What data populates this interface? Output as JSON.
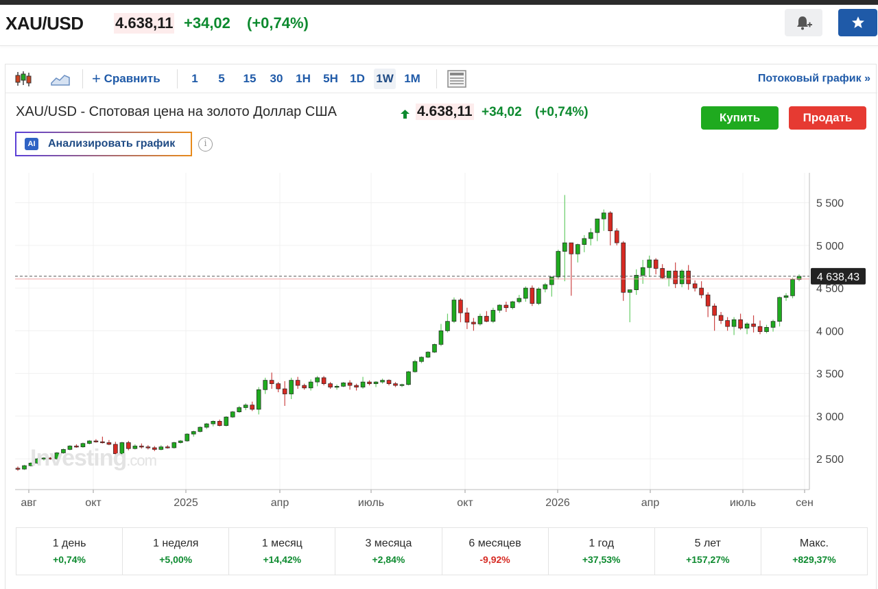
{
  "header": {
    "symbol": "XAU/USD",
    "price": "4.638,11",
    "change": "+34,02",
    "change_pct": "(+0,74%)"
  },
  "toolbar": {
    "compare_label": "Сравнить",
    "intervals": [
      "1",
      "5",
      "15",
      "30",
      "1H",
      "5H",
      "1D",
      "1W",
      "1M"
    ],
    "active_interval": "1W",
    "stream_label": "Потоковый график »"
  },
  "instrument": {
    "title": "XAU/USD - Спотовая цена на золото Доллар США",
    "price": "4.638,11",
    "change": "+34,02",
    "change_pct": "(+0,74%)",
    "buy_label": "Купить",
    "sell_label": "Продать",
    "ai_badge": "AI",
    "ai_label": "Анализировать график",
    "info_symbol": "i"
  },
  "watermark": {
    "brand": "Investing",
    "suffix": ".com"
  },
  "colors": {
    "up": "#1faa1f",
    "down": "#d62a23",
    "accent": "#1f5aa8"
  },
  "chart_data": {
    "type": "candlestick",
    "x_tick_labels": [
      "авг",
      "окт",
      "2025",
      "апр",
      "июль",
      "окт",
      "2026",
      "апр",
      "июль",
      "сен"
    ],
    "y_tick_labels": [
      "2 500",
      "3 000",
      "3 500",
      "4 000",
      "4 500",
      "5 000",
      "5 500"
    ],
    "y_ticks": [
      2500,
      3000,
      3500,
      4000,
      4500,
      5000,
      5500
    ],
    "ylim": [
      2140,
      5850
    ],
    "current_price_label": "4 638,43",
    "current_price": 4638.43,
    "candles": [
      [
        2390,
        2410,
        2360,
        2380
      ],
      [
        2380,
        2430,
        2370,
        2420
      ],
      [
        2420,
        2460,
        2410,
        2450
      ],
      [
        2450,
        2510,
        2440,
        2500
      ],
      [
        2500,
        2520,
        2480,
        2510
      ],
      [
        2510,
        2520,
        2490,
        2500
      ],
      [
        2500,
        2580,
        2490,
        2570
      ],
      [
        2570,
        2620,
        2560,
        2610
      ],
      [
        2610,
        2660,
        2600,
        2650
      ],
      [
        2650,
        2670,
        2630,
        2640
      ],
      [
        2640,
        2690,
        2630,
        2680
      ],
      [
        2680,
        2720,
        2670,
        2710
      ],
      [
        2710,
        2730,
        2690,
        2700
      ],
      [
        2700,
        2760,
        2680,
        2690
      ],
      [
        2690,
        2720,
        2660,
        2670
      ],
      [
        2670,
        2700,
        2540,
        2560
      ],
      [
        2560,
        2700,
        2550,
        2690
      ],
      [
        2690,
        2710,
        2600,
        2620
      ],
      [
        2620,
        2670,
        2610,
        2650
      ],
      [
        2650,
        2680,
        2620,
        2640
      ],
      [
        2640,
        2660,
        2610,
        2630
      ],
      [
        2630,
        2650,
        2590,
        2610
      ],
      [
        2610,
        2660,
        2600,
        2640
      ],
      [
        2640,
        2660,
        2620,
        2630
      ],
      [
        2630,
        2700,
        2620,
        2690
      ],
      [
        2690,
        2720,
        2680,
        2710
      ],
      [
        2710,
        2800,
        2700,
        2790
      ],
      [
        2790,
        2830,
        2760,
        2820
      ],
      [
        2820,
        2880,
        2810,
        2870
      ],
      [
        2870,
        2920,
        2850,
        2910
      ],
      [
        2910,
        2950,
        2880,
        2940
      ],
      [
        2940,
        2960,
        2880,
        2890
      ],
      [
        2890,
        3000,
        2880,
        2990
      ],
      [
        2990,
        3060,
        2980,
        3050
      ],
      [
        3050,
        3120,
        3040,
        3100
      ],
      [
        3100,
        3150,
        3070,
        3130
      ],
      [
        3130,
        3170,
        3060,
        3080
      ],
      [
        3080,
        3340,
        3020,
        3310
      ],
      [
        3310,
        3450,
        3260,
        3420
      ],
      [
        3420,
        3510,
        3320,
        3380
      ],
      [
        3380,
        3400,
        3280,
        3320
      ],
      [
        3320,
        3410,
        3120,
        3260
      ],
      [
        3260,
        3450,
        3200,
        3420
      ],
      [
        3420,
        3460,
        3320,
        3360
      ],
      [
        3360,
        3380,
        3310,
        3330
      ],
      [
        3330,
        3430,
        3300,
        3400
      ],
      [
        3400,
        3470,
        3350,
        3450
      ],
      [
        3450,
        3470,
        3360,
        3380
      ],
      [
        3380,
        3400,
        3320,
        3340
      ],
      [
        3340,
        3370,
        3310,
        3350
      ],
      [
        3350,
        3400,
        3340,
        3390
      ],
      [
        3390,
        3420,
        3310,
        3360
      ],
      [
        3360,
        3380,
        3300,
        3340
      ],
      [
        3340,
        3460,
        3320,
        3400
      ],
      [
        3400,
        3420,
        3360,
        3380
      ],
      [
        3380,
        3410,
        3340,
        3400
      ],
      [
        3400,
        3440,
        3380,
        3420
      ],
      [
        3420,
        3430,
        3360,
        3380
      ],
      [
        3380,
        3400,
        3340,
        3360
      ],
      [
        3360,
        3380,
        3340,
        3370
      ],
      [
        3370,
        3530,
        3360,
        3520
      ],
      [
        3520,
        3660,
        3510,
        3640
      ],
      [
        3640,
        3700,
        3620,
        3690
      ],
      [
        3690,
        3760,
        3680,
        3750
      ],
      [
        3750,
        3850,
        3740,
        3840
      ],
      [
        3840,
        4080,
        3820,
        4000
      ],
      [
        4000,
        4200,
        3980,
        4110
      ],
      [
        4110,
        4390,
        4090,
        4360
      ],
      [
        4360,
        4380,
        4100,
        4210
      ],
      [
        4210,
        4270,
        4020,
        4100
      ],
      [
        4100,
        4150,
        4000,
        4080
      ],
      [
        4080,
        4200,
        4060,
        4170
      ],
      [
        4170,
        4230,
        4100,
        4110
      ],
      [
        4110,
        4270,
        4090,
        4240
      ],
      [
        4240,
        4310,
        4210,
        4300
      ],
      [
        4300,
        4340,
        4220,
        4270
      ],
      [
        4270,
        4350,
        4250,
        4340
      ],
      [
        4340,
        4420,
        4320,
        4380
      ],
      [
        4380,
        4520,
        4340,
        4500
      ],
      [
        4500,
        4530,
        4290,
        4320
      ],
      [
        4320,
        4510,
        4300,
        4490
      ],
      [
        4490,
        4560,
        4450,
        4540
      ],
      [
        4540,
        4600,
        4400,
        4630
      ],
      [
        4630,
        4950,
        4600,
        4930
      ],
      [
        4930,
        5590,
        4580,
        5030
      ],
      [
        5030,
        4900,
        4410,
        4900
      ],
      [
        4900,
        5020,
        4800,
        5010
      ],
      [
        5010,
        5120,
        4920,
        5080
      ],
      [
        5080,
        5200,
        5000,
        5150
      ],
      [
        5150,
        5300,
        5050,
        5310
      ],
      [
        5310,
        5420,
        5170,
        5380
      ],
      [
        5380,
        5400,
        5000,
        5170
      ],
      [
        5170,
        5200,
        5000,
        5030
      ],
      [
        5030,
        5050,
        4350,
        4450
      ],
      [
        4450,
        4480,
        4100,
        4480
      ],
      [
        4480,
        4720,
        4420,
        4650
      ],
      [
        4650,
        4830,
        4550,
        4740
      ],
      [
        4740,
        4880,
        4630,
        4830
      ],
      [
        4830,
        4850,
        4660,
        4730
      ],
      [
        4730,
        4780,
        4610,
        4620
      ],
      [
        4620,
        4700,
        4520,
        4700
      ],
      [
        4700,
        4800,
        4500,
        4550
      ],
      [
        4550,
        4720,
        4510,
        4700
      ],
      [
        4700,
        4770,
        4480,
        4550
      ],
      [
        4550,
        4590,
        4460,
        4500
      ],
      [
        4500,
        4580,
        4380,
        4420
      ],
      [
        4420,
        4450,
        4160,
        4290
      ],
      [
        4290,
        4320,
        4000,
        4180
      ],
      [
        4180,
        4220,
        4080,
        4120
      ],
      [
        4120,
        4160,
        4000,
        4050
      ],
      [
        4050,
        4160,
        3950,
        4130
      ],
      [
        4130,
        4200,
        4010,
        4030
      ],
      [
        4030,
        4100,
        3960,
        4080
      ],
      [
        4080,
        4180,
        3980,
        4050
      ],
      [
        4050,
        4120,
        3960,
        3990
      ],
      [
        3990,
        4070,
        3970,
        4040
      ],
      [
        4040,
        4130,
        3990,
        4110
      ],
      [
        4110,
        4400,
        4050,
        4390
      ],
      [
        4390,
        4440,
        4350,
        4410
      ],
      [
        4410,
        4620,
        4380,
        4600
      ],
      [
        4600,
        4660,
        4580,
        4638.43
      ]
    ]
  },
  "performance": [
    {
      "label": "1 день",
      "value": "+0,74%",
      "dir": "pos"
    },
    {
      "label": "1 неделя",
      "value": "+5,00%",
      "dir": "pos"
    },
    {
      "label": "1 месяц",
      "value": "+14,42%",
      "dir": "pos"
    },
    {
      "label": "3 месяца",
      "value": "+2,84%",
      "dir": "pos"
    },
    {
      "label": "6 месяцев",
      "value": "-9,92%",
      "dir": "neg"
    },
    {
      "label": "1 год",
      "value": "+37,53%",
      "dir": "pos"
    },
    {
      "label": "5 лет",
      "value": "+157,27%",
      "dir": "pos"
    },
    {
      "label": "Макс.",
      "value": "+829,37%",
      "dir": "pos"
    }
  ]
}
